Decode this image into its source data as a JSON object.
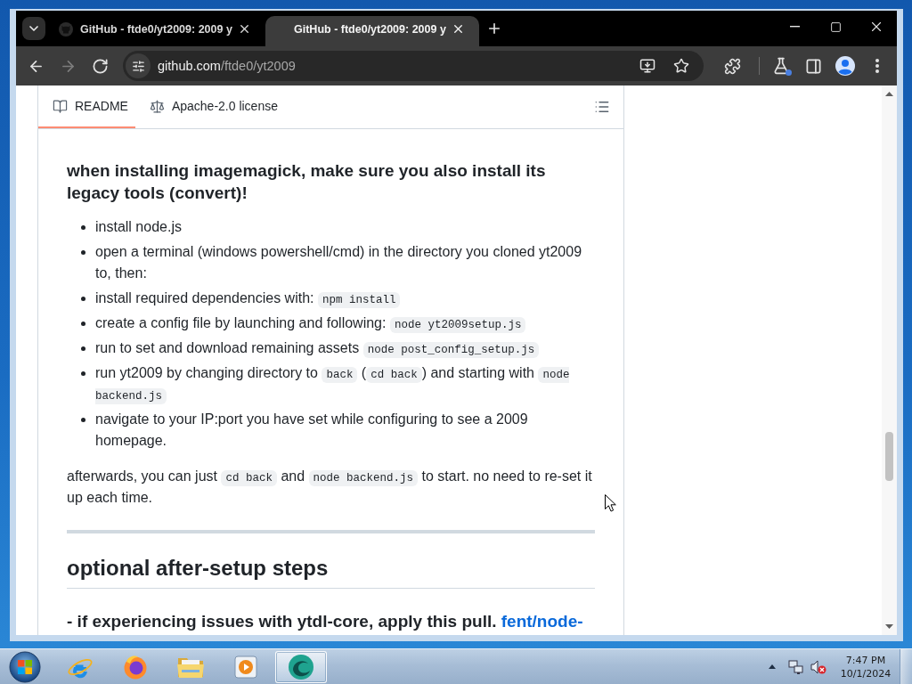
{
  "browser": {
    "tabs": [
      {
        "title": "GitHub - ftde0/yt2009: 2009 y",
        "selected": false
      },
      {
        "title": "GitHub - ftde0/yt2009: 2009 y",
        "selected": true
      }
    ],
    "navigation": [
      {
        "kind": "back",
        "disabled": false
      },
      {
        "kind": "forward",
        "disabled": true
      },
      {
        "kind": "reload",
        "disabled": false
      }
    ],
    "address_bar": {
      "host": "github.com",
      "path": "/ftde0/yt2009"
    }
  },
  "readme": {
    "tabs": [
      {
        "kind": "readme",
        "label": "README",
        "selected": true
      },
      {
        "kind": "license",
        "label": "Apache-2.0 license",
        "selected": false
      }
    ],
    "blocks": [
      {
        "kind": "heading3",
        "segments": [
          {
            "kind": "text",
            "text": "when installing imagemagick, make sure you also install its legacy tools (convert)!"
          }
        ]
      },
      {
        "kind": "list",
        "items": [
          {
            "segments": [
              {
                "kind": "text",
                "text": "install node.js"
              }
            ]
          },
          {
            "segments": [
              {
                "kind": "text",
                "text": "open a terminal (windows powershell/cmd) in the directory you cloned yt2009 to, then:"
              }
            ]
          },
          {
            "segments": [
              {
                "kind": "text",
                "text": "install required dependencies with: "
              },
              {
                "kind": "code",
                "text": "npm install"
              }
            ]
          },
          {
            "segments": [
              {
                "kind": "text",
                "text": "create a config file by launching and following: "
              },
              {
                "kind": "code",
                "text": "node yt2009setup.js"
              }
            ]
          },
          {
            "segments": [
              {
                "kind": "text",
                "text": "run to set and download remaining assets "
              },
              {
                "kind": "code",
                "text": "node post_config_setup.js"
              }
            ]
          },
          {
            "segments": [
              {
                "kind": "text",
                "text": "run yt2009 by changing directory to "
              },
              {
                "kind": "code",
                "text": "back"
              },
              {
                "kind": "text",
                "text": " ("
              },
              {
                "kind": "code",
                "text": "cd back"
              },
              {
                "kind": "text",
                "text": ") and starting with "
              },
              {
                "kind": "code",
                "text": "node backend.js"
              }
            ]
          },
          {
            "segments": [
              {
                "kind": "text",
                "text": "navigate to your IP:port you have set while configuring to see a 2009 homepage."
              }
            ]
          }
        ]
      },
      {
        "kind": "paragraph",
        "segments": [
          {
            "kind": "text",
            "text": "afterwards, you can just "
          },
          {
            "kind": "code",
            "text": "cd back"
          },
          {
            "kind": "text",
            "text": " and "
          },
          {
            "kind": "code",
            "text": "node backend.js"
          },
          {
            "kind": "text",
            "text": " to start. no need to re-set it up each time."
          }
        ]
      },
      {
        "kind": "rule"
      },
      {
        "kind": "heading2",
        "segments": [
          {
            "kind": "text",
            "text": "optional after-setup steps"
          }
        ]
      },
      {
        "kind": "heading3",
        "segments": [
          {
            "kind": "text",
            "text": "- if experiencing issues with ytdl-core, apply this pull. "
          },
          {
            "kind": "link",
            "text": "fent/node-"
          }
        ]
      }
    ]
  },
  "taskbar": {
    "apps": [
      {
        "kind": "letter-e",
        "active": false
      },
      {
        "kind": "globe",
        "active": false
      },
      {
        "kind": "folder",
        "active": false
      },
      {
        "kind": "media",
        "active": false
      },
      {
        "kind": "crescent",
        "active": true
      }
    ],
    "tray": {
      "volume_muted": true
    },
    "clock": {
      "time": "7:47 PM",
      "date": "10/1/2024"
    }
  }
}
